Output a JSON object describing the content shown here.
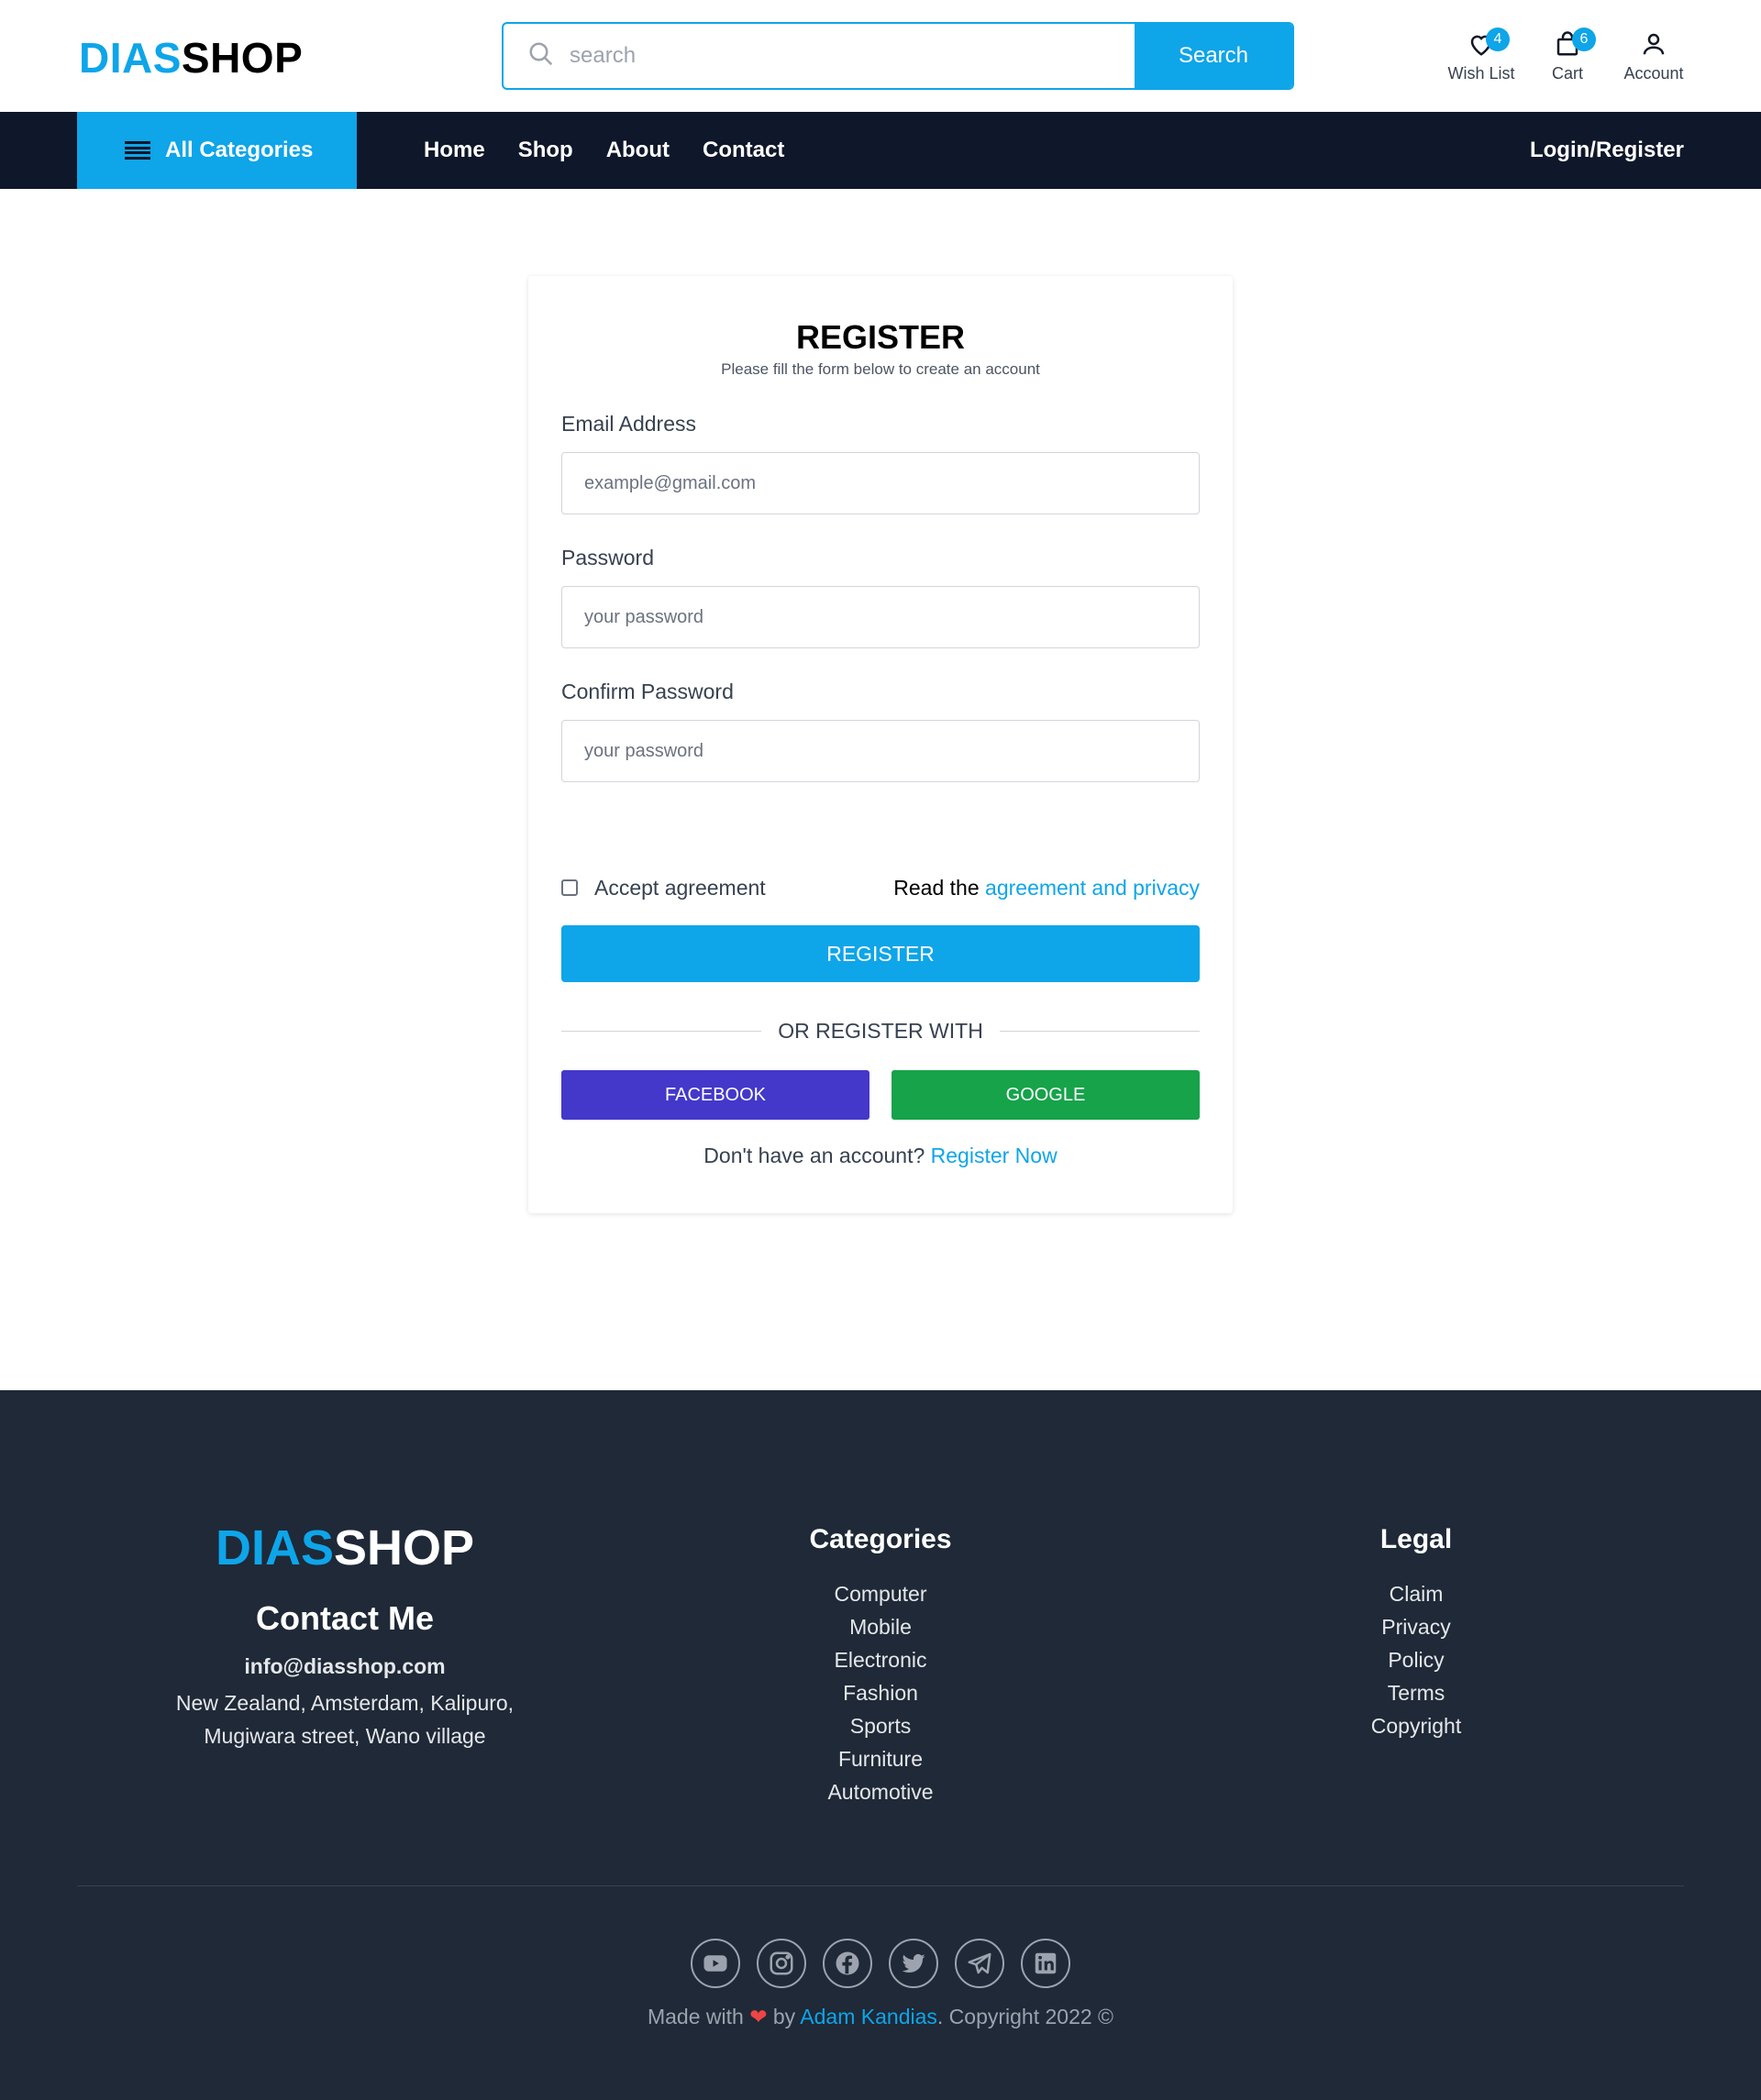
{
  "header": {
    "logo_part1": "DIAS",
    "logo_part2": "SHOP",
    "search_placeholder": "search",
    "search_button": "Search",
    "icons": [
      {
        "label": "Wish List",
        "count": "4",
        "icon": "heart-icon"
      },
      {
        "label": "Cart",
        "count": "6",
        "icon": "bag-icon"
      },
      {
        "label": "Account",
        "icon": "user-icon"
      }
    ]
  },
  "nav": {
    "all_categories": "All Categories",
    "links": [
      "Home",
      "Shop",
      "About",
      "Contact"
    ],
    "login": "Login/Register"
  },
  "form": {
    "title": "REGISTER",
    "subtitle": "Please fill the form below to create an account",
    "email_label": "Email Address",
    "email_placeholder": "example@gmail.com",
    "password_label": "Password",
    "password_placeholder": "your password",
    "confirm_label": "Confirm Password",
    "confirm_placeholder": "your password",
    "accept_label": "Accept agreement",
    "read_prefix": "Read the",
    "read_link": "agreement and privacy",
    "register_button": "REGISTER",
    "or_text": "OR REGISTER WITH",
    "facebook": "FACEBOOK",
    "google": "GOOGLE",
    "no_account": "Don't have an account?",
    "register_now": "Register Now"
  },
  "footer": {
    "logo_part1": "DIAS",
    "logo_part2": "SHOP",
    "contact_title": "Contact Me",
    "email": "info@diasshop.com",
    "address_line1": "New Zealand, Amsterdam, Kalipuro,",
    "address_line2": "Mugiwara street, Wano village",
    "categories_title": "Categories",
    "categories": [
      "Computer",
      "Mobile",
      "Electronic",
      "Fashion",
      "Sports",
      "Furniture",
      "Automotive"
    ],
    "legal_title": "Legal",
    "legal": [
      "Claim",
      "Privacy",
      "Policy",
      "Terms",
      "Copyright"
    ],
    "socials": [
      "youtube-icon",
      "instagram-icon",
      "facebook-icon",
      "twitter-icon",
      "telegram-icon",
      "linkedin-icon"
    ],
    "made_prefix": "Made with",
    "made_by": "by",
    "author": "Adam Kandias",
    "copyright": ". Copyright 2022 ©"
  },
  "colors": {
    "accent": "#0ea5e9",
    "nav_bg": "#0f172a",
    "footer_bg": "#1f2937",
    "facebook": "#4338ca",
    "google": "#16a34a"
  }
}
